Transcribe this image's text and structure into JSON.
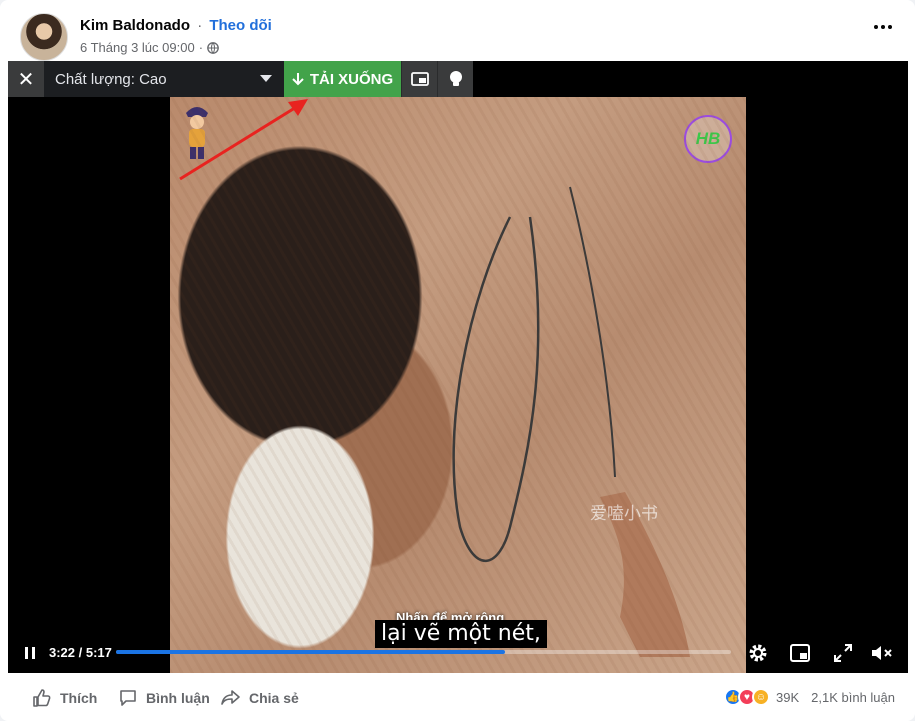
{
  "post": {
    "author": "Kim Baldonado",
    "separator": "·",
    "follow_label": "Theo dõi",
    "timestamp": "6 Tháng 3 lúc 09:00"
  },
  "video": {
    "quality_label": "Chất lượng: Cao",
    "download_label": "TẢI XUỐNG",
    "logo_text": "HB",
    "watermark_text": "爱嗑小书",
    "caption_hint": "Nhấp để mở rộng",
    "caption_text": "lại vẽ một nét,",
    "time_display": "3:22 / 5:17",
    "progress_fraction": 0.633
  },
  "footer": {
    "like_label": "Thích",
    "comment_label": "Bình luận",
    "share_label": "Chia sẻ",
    "reaction_count": "39K",
    "comment_count": "2,1K bình luận"
  },
  "colors": {
    "download_green": "#42a34a",
    "progress_blue": "#1b74e4",
    "follow_blue": "#216fdb",
    "annotation_red": "#e8231f"
  }
}
